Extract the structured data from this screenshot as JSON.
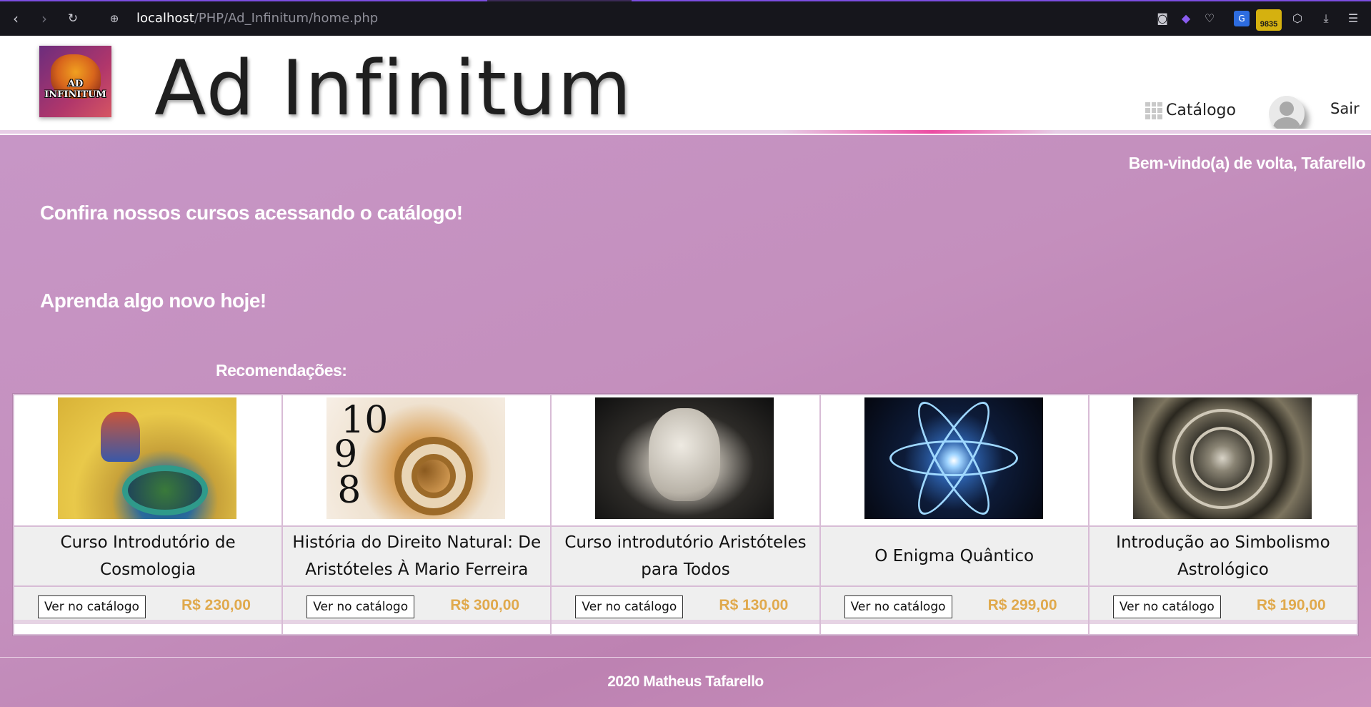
{
  "browser": {
    "url_host": "localhost",
    "url_path": "/PHP/Ad_Infinitum/home.php",
    "extension_badge": "9835"
  },
  "header": {
    "logo_text": "AD INFINITUM",
    "site_title": "Ad Infinitum",
    "catalog_label": "Catálogo",
    "logout_label": "Sair"
  },
  "main": {
    "welcome": "Bem-vindo(a) de volta, Tafarello",
    "headline1": "Confira nossos cursos acessando o catálogo!",
    "headline2": "Aprenda algo novo hoje!",
    "recommendations_title": "Recomendações:"
  },
  "courses": [
    {
      "name": "Curso Introdutório de Cosmologia",
      "button": "Ver no catálogo",
      "price": "R$ 230,00",
      "image": "cosmology-painting"
    },
    {
      "name": "História do Direito Natural: De Aristóteles À Mario Ferreira",
      "button": "Ver no catálogo",
      "price": "R$ 300,00",
      "image": "spiral-clock"
    },
    {
      "name": "Curso introdutório Aristóteles para Todos",
      "button": "Ver no catálogo",
      "price": "R$ 130,00",
      "image": "aristotle-bust"
    },
    {
      "name": "O Enigma Quântico",
      "button": "Ver no catálogo",
      "price": "R$ 299,00",
      "image": "quantum-atom"
    },
    {
      "name": "Introdução ao Simbolismo Astrológico",
      "button": "Ver no catálogo",
      "price": "R$ 190,00",
      "image": "astrological-engraving"
    }
  ],
  "footer": {
    "text": "2020 Matheus Tafarello"
  },
  "colors": {
    "background": "#c48fbd",
    "price": "#e0a94c",
    "accent_line": "#ec4ca3"
  }
}
